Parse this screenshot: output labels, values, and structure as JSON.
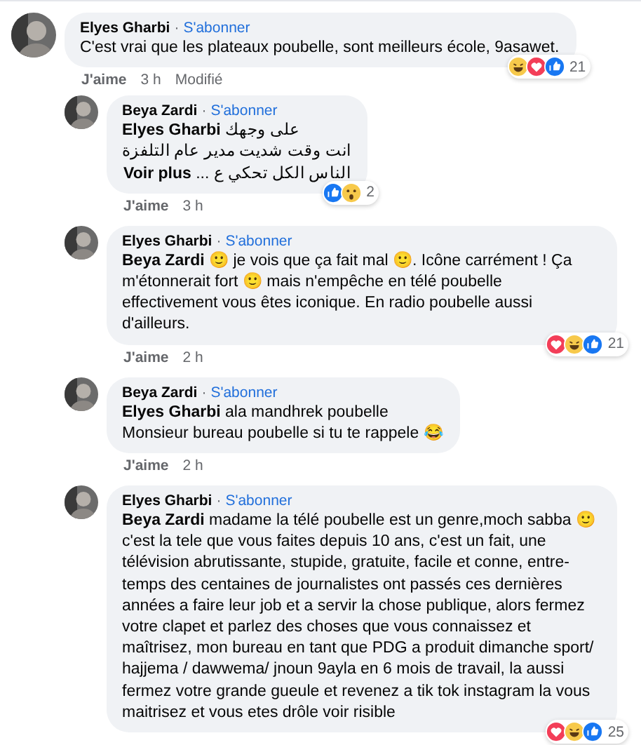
{
  "comments": [
    {
      "author": "Elyes Gharbi",
      "separator": "·",
      "follow": "S'abonner",
      "lines": [
        "C'est vrai que les plateaux poubelle, sont meilleurs école, 9asawet."
      ],
      "reactions": {
        "icons": [
          {
            "kind": "haha"
          },
          {
            "kind": "love"
          },
          {
            "kind": "like"
          }
        ],
        "count": "21"
      },
      "actions": {
        "like": "J'aime",
        "time": "3 h",
        "edited": "Modifié"
      },
      "children": [
        {
          "author": "Beya Zardi",
          "separator": "·",
          "follow": "S'abonner",
          "lines": [
            "**Elyes Gharbi** على وجهك",
            "انت وقت شديت مدير عام التلفزة",
            "الناس الكل تحكي ع ..."
          ],
          "more": "Voir plus",
          "reactions": {
            "icons": [
              {
                "kind": "like"
              },
              {
                "kind": "wow"
              }
            ],
            "count": "2"
          },
          "actions": {
            "like": "J'aime",
            "time": "3 h"
          }
        },
        {
          "author": "Elyes Gharbi",
          "separator": "·",
          "follow": "S'abonner",
          "lines": [
            "**Beya Zardi** 🙂 je vois que ça fait mal 🙂. Icône carrément ! Ça m'étonnerait fort 🙂 mais n'empêche en télé poubelle effectivement vous êtes iconique. En radio poubelle aussi d'ailleurs."
          ],
          "reactions": {
            "icons": [
              {
                "kind": "love"
              },
              {
                "kind": "haha"
              },
              {
                "kind": "like"
              }
            ],
            "count": "21"
          },
          "actions": {
            "like": "J'aime",
            "time": "2 h"
          }
        },
        {
          "author": "Beya Zardi",
          "separator": "·",
          "follow": "S'abonner",
          "lines": [
            "**Elyes Gharbi** ala mandhrek poubelle",
            "Monsieur bureau poubelle si tu te rappele 😂"
          ],
          "actions": {
            "like": "J'aime",
            "time": "2 h"
          }
        },
        {
          "author": "Elyes Gharbi",
          "separator": "·",
          "follow": "S'abonner",
          "lines": [
            "**Beya Zardi** madame la télé poubelle est un genre,moch sabba 🙂 c'est la tele que vous faites depuis 10 ans, c'est un fait, une télévision abrutissante, stupide, gratuite, facile et conne, entre-temps des centaines de journalistes ont passés ces dernières années a faire leur job et a servir la chose publique, alors fermez votre clapet et parlez des choses que vous connaissez et maîtrisez, mon bureau en tant que PDG a produit dimanche sport/ hajjema / dawwema/ jnoun 9ayla en 6 mois de travail, la aussi fermez votre grande gueule et revenez a tik tok instagram la vous maitrisez et vous etes drôle voir risible"
          ],
          "reactions": {
            "icons": [
              {
                "kind": "love"
              },
              {
                "kind": "haha"
              },
              {
                "kind": "like"
              }
            ],
            "count": "25"
          }
        }
      ]
    }
  ]
}
